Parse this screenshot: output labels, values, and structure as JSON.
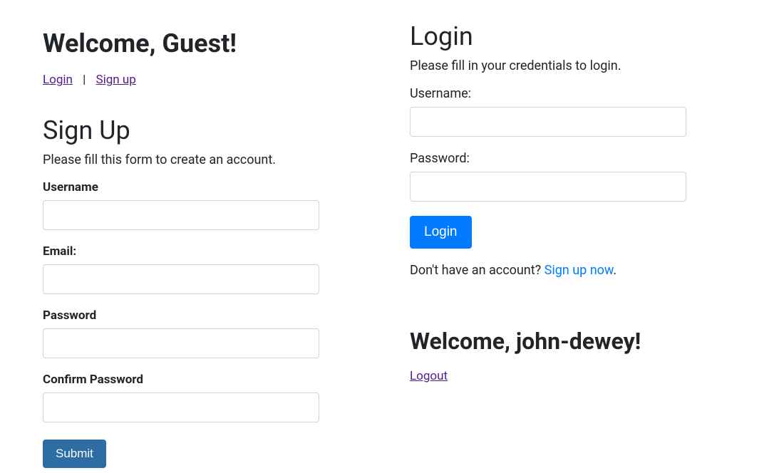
{
  "guest": {
    "heading": "Welcome, Guest!",
    "login_link": "Login",
    "separator": "|",
    "signup_link": "Sign up"
  },
  "signup": {
    "heading": "Sign Up",
    "subtext": "Please fill this form to create an account.",
    "labels": {
      "username": "Username",
      "email": "Email:",
      "password": "Password",
      "confirm_password": "Confirm Password"
    },
    "values": {
      "username": "",
      "email": "",
      "password": "",
      "confirm_password": ""
    },
    "submit": "Submit"
  },
  "login": {
    "heading": "Login",
    "subtext": "Please fill in your credentials to login.",
    "labels": {
      "username": "Username:",
      "password": "Password:"
    },
    "values": {
      "username": "",
      "password": ""
    },
    "submit": "Login",
    "prompt_prefix": "Don't have an account? ",
    "prompt_link": "Sign up now",
    "prompt_suffix": "."
  },
  "user": {
    "heading": "Welcome, john-dewey!",
    "logout": "Logout"
  }
}
